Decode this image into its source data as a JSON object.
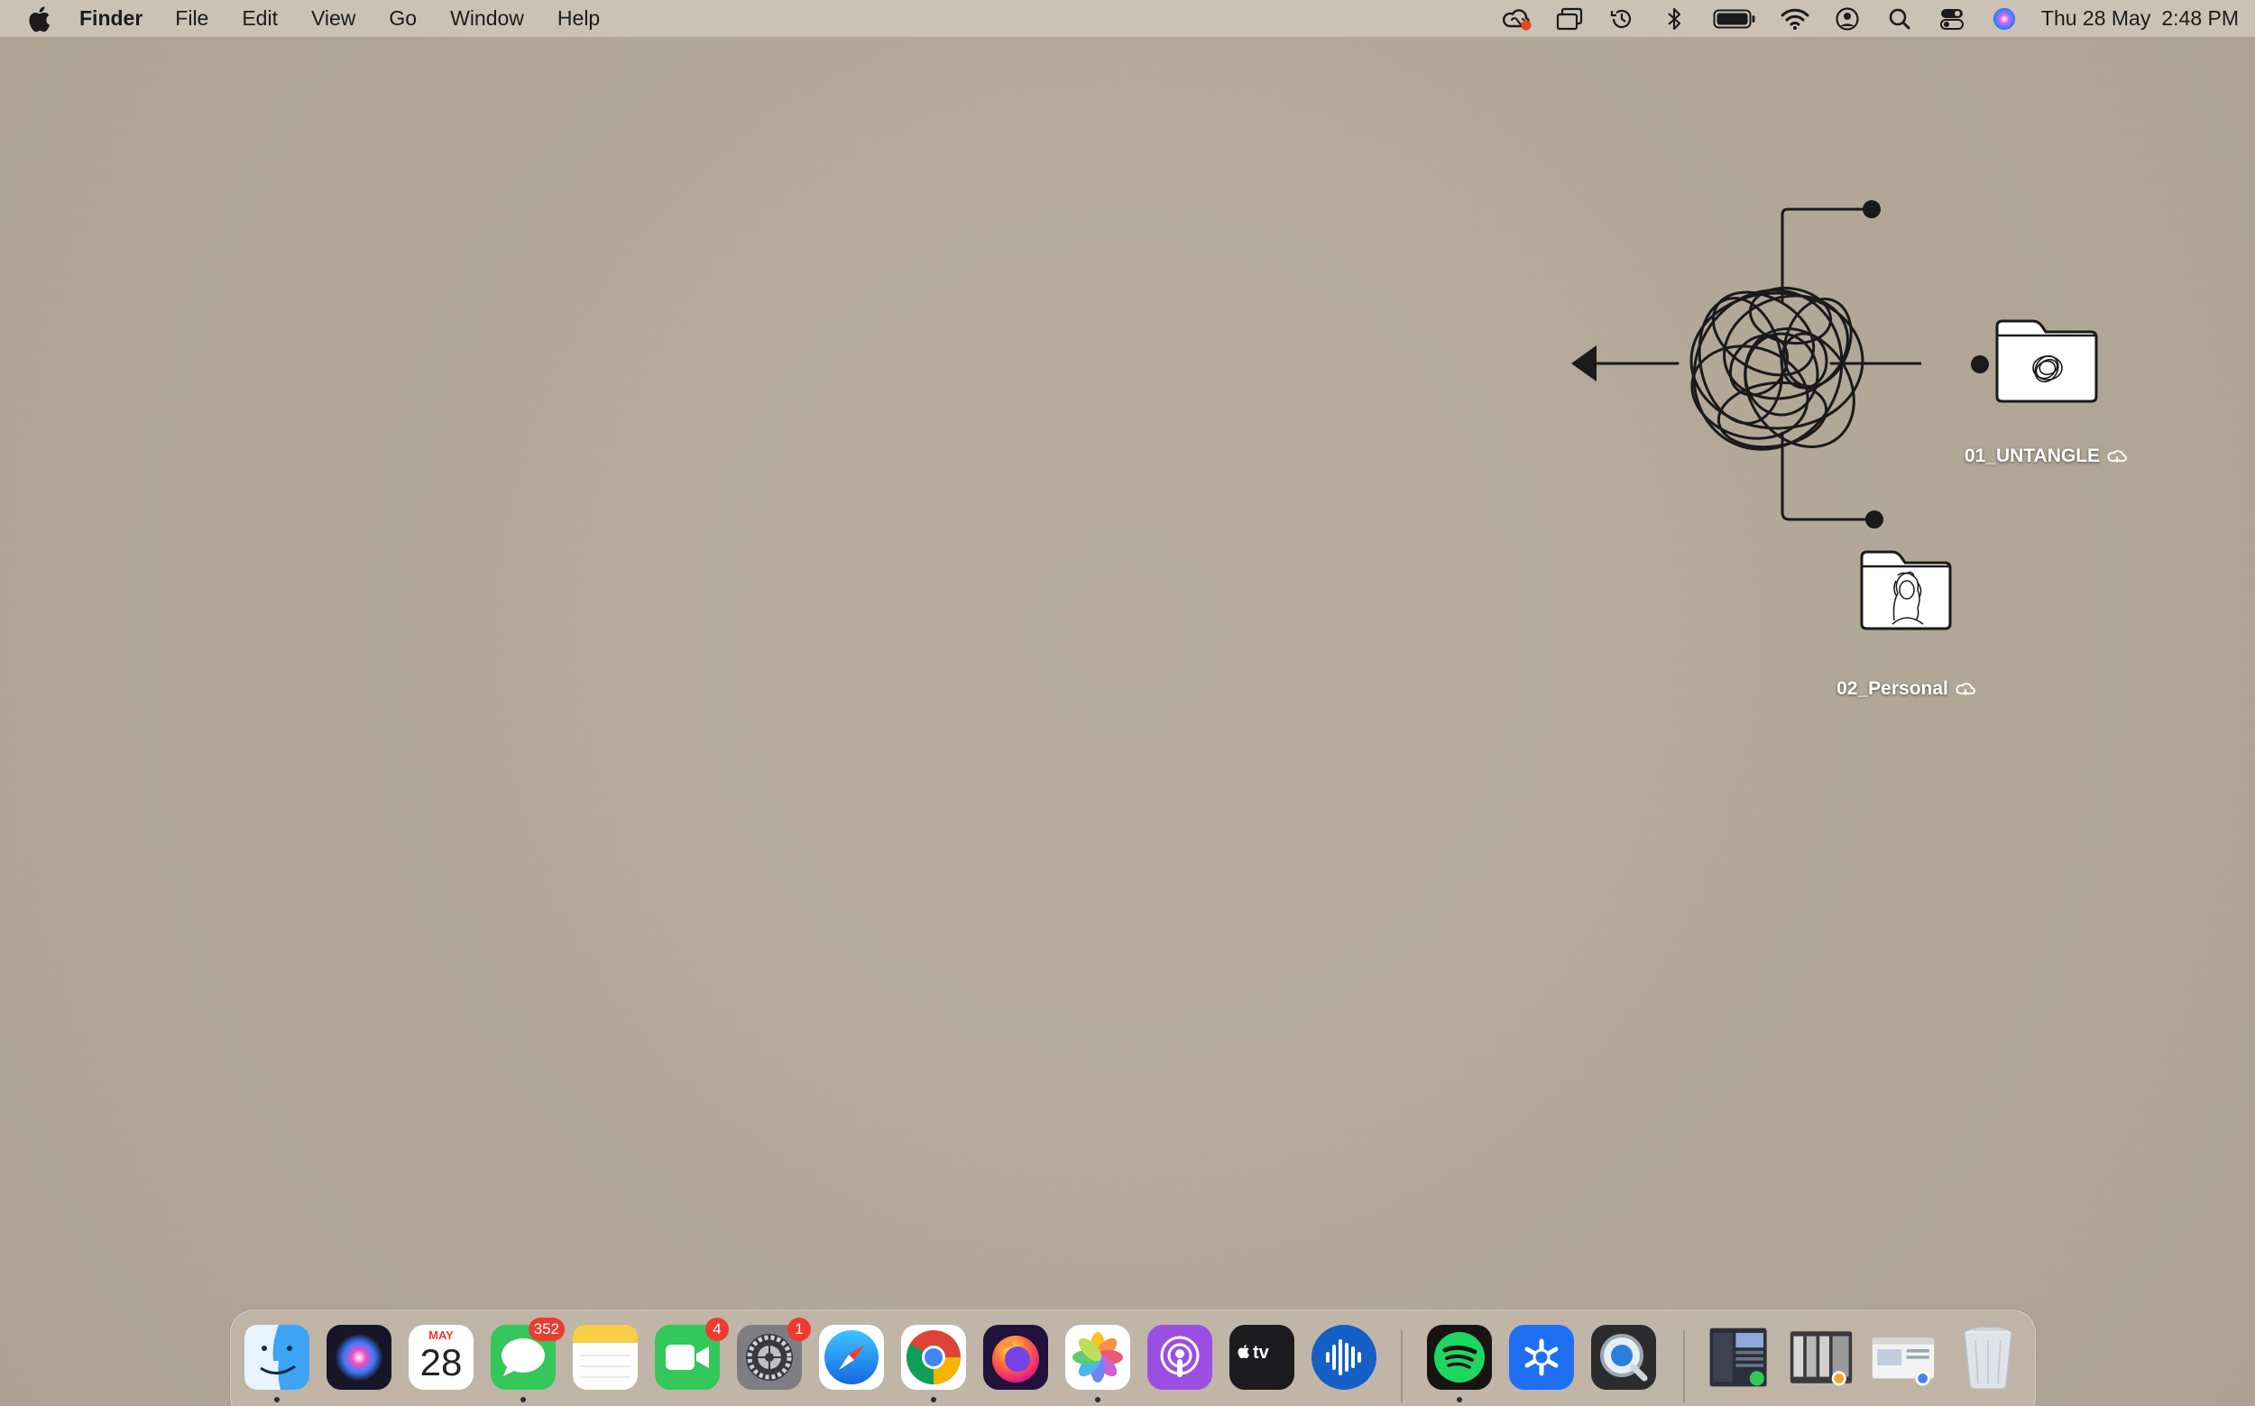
{
  "menubar": {
    "app_name": "Finder",
    "menus": [
      "File",
      "Edit",
      "View",
      "Go",
      "Window",
      "Help"
    ],
    "status_icons": [
      "creative-cloud-icon",
      "screen-mirroring-icon",
      "time-machine-icon",
      "bluetooth-icon",
      "battery-icon",
      "wifi-icon",
      "user-icon",
      "spotlight-icon",
      "control-center-icon",
      "siri-icon"
    ],
    "clock": {
      "date": "Thu 28 May",
      "time": "2:48 PM"
    }
  },
  "desktop": {
    "icons": [
      {
        "label": "01_UNTANGLE",
        "cloud_status": "cloud-icon"
      },
      {
        "label": "02_Personal",
        "cloud_status": "cloud-icon"
      }
    ]
  },
  "dock": {
    "calendar": {
      "month": "MAY",
      "day": "28"
    },
    "apps": [
      {
        "name": "Finder",
        "running": true
      },
      {
        "name": "Siri"
      },
      {
        "name": "Calendar"
      },
      {
        "name": "Messages",
        "badge": "352",
        "running": true
      },
      {
        "name": "Notes"
      },
      {
        "name": "FaceTime",
        "badge": "4"
      },
      {
        "name": "System Settings",
        "badge": "1"
      },
      {
        "name": "Safari"
      },
      {
        "name": "Google Chrome",
        "running": true
      },
      {
        "name": "Firefox"
      },
      {
        "name": "Photos",
        "running": true
      },
      {
        "name": "Podcasts"
      },
      {
        "name": "Apple TV",
        "label": "tv"
      },
      {
        "name": "Audio App"
      },
      {
        "name": "Spotify",
        "running": true
      },
      {
        "name": "App Store Connect"
      },
      {
        "name": "QuickTime"
      },
      {
        "name": "Recent Windows 1"
      },
      {
        "name": "Recent Windows 2"
      },
      {
        "name": "Recent Windows 3"
      },
      {
        "name": "Trash"
      }
    ],
    "colors": {
      "badge": "#ee3b30",
      "messages": "#34c759",
      "facetime": "#34c759",
      "spotify": "#1ed760"
    }
  }
}
